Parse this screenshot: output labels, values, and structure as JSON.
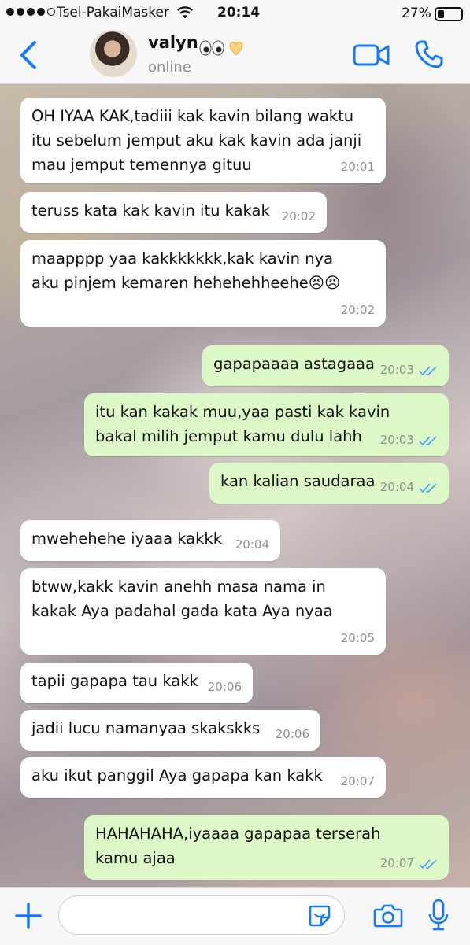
{
  "status_bar": {
    "signal_dots": [
      true,
      true,
      true,
      true,
      false
    ],
    "carrier": "Tsel-PakaiMasker",
    "time": "20:14",
    "battery_percent_label": "27%",
    "battery_level": 0.27
  },
  "header": {
    "contact_name": "valyn",
    "presence": "online",
    "accent_color": "#1479ff"
  },
  "messages": [
    {
      "direction": "in",
      "text": "OH IYAA KAK,tadiii kak kavin bilang waktu\nitu sebelum jemput aku kak kavin ada janji\nmau jemput temennya gituu",
      "time": "20:01"
    },
    {
      "direction": "in",
      "text": "teruss kata kak kavin itu kakak",
      "time": "20:02"
    },
    {
      "direction": "in",
      "text": "maapppp yaa kakkkkkkk,kak kavin nya\naku pinjem kemaren hehehehheehe😣😣",
      "time": "20:02"
    },
    {
      "direction": "out",
      "text": "gapapaaaa astagaaa",
      "time": "20:03",
      "read": true
    },
    {
      "direction": "out",
      "text": "itu kan kakak muu,yaa pasti kak kavin\nbakal milih jemput kamu dulu lahh",
      "time": "20:03",
      "read": true
    },
    {
      "direction": "out",
      "text": "kan kalian saudaraa",
      "time": "20:04",
      "read": true
    },
    {
      "direction": "in",
      "text": "mwehehehe iyaaa kakkk",
      "time": "20:04"
    },
    {
      "direction": "in",
      "text": "btww,kakk kavin anehh masa nama in\nkakak Aya padahal gada kata Aya nyaa",
      "time": "20:05"
    },
    {
      "direction": "in",
      "text": "tapii gapapa tau kakk",
      "time": "20:06"
    },
    {
      "direction": "in",
      "text": "jadii lucu namanyaa skakskks",
      "time": "20:06"
    },
    {
      "direction": "in",
      "text": "aku ikut panggil Aya gapapa kan kakk",
      "time": "20:07"
    },
    {
      "direction": "out",
      "text": "HAHAHAHA,iyaaaa gapapaa terserah\nkamu ajaa",
      "time": "20:07",
      "read": true
    }
  ],
  "input_bar": {
    "placeholder": ""
  },
  "colors": {
    "incoming_bubble": "#ffffff",
    "outgoing_bubble": "#dcf8c6",
    "read_tick": "#4fa7ff"
  }
}
